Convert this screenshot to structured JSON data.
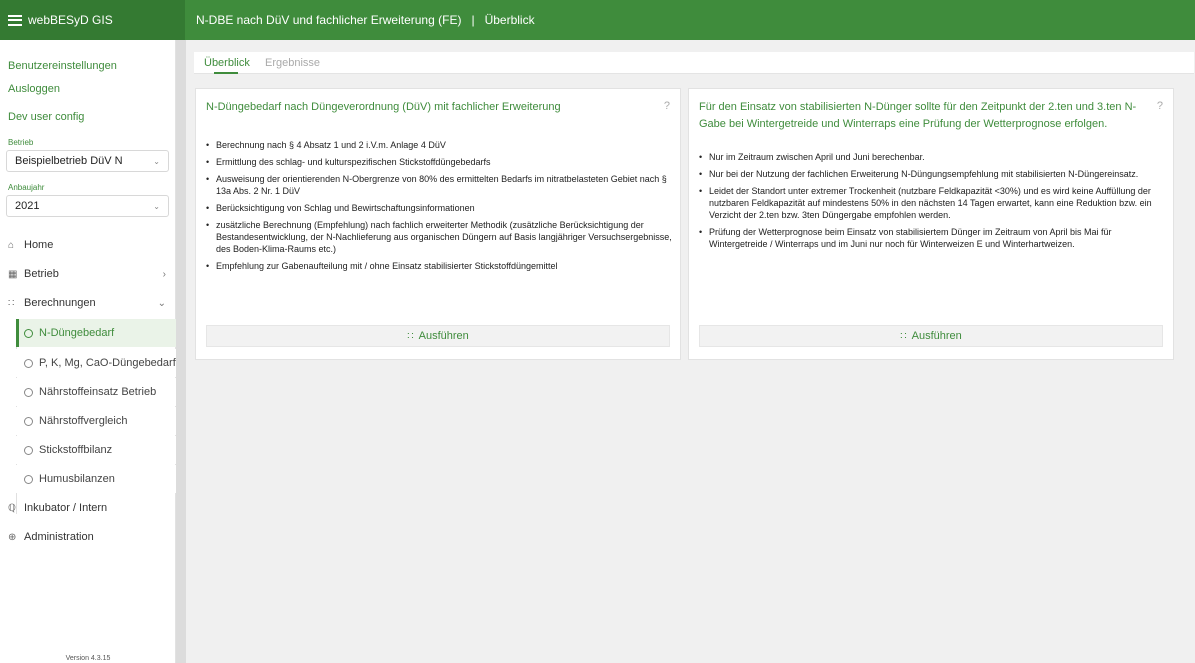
{
  "app": {
    "brand": "webBESyD GIS",
    "title": "N-DBE nach DüV und fachlicher Erweiterung (FE)   |   Überblick"
  },
  "sidebar": {
    "links": [
      "Benutzereinstellungen",
      "Ausloggen",
      "Dev user config"
    ],
    "betrieb_label": "Betrieb",
    "betrieb_value": "Beispielbetrieb DüV N",
    "anbaujahr_label": "Anbaujahr",
    "anbaujahr_value": "2021",
    "nav": {
      "home": "Home",
      "betrieb": "Betrieb",
      "berechnungen": "Berechnungen",
      "inkubator": "Inkubator / Intern",
      "administration": "Administration"
    },
    "sub_items": [
      "N-Düngebedarf",
      "P, K, Mg, CaO-Düngebedarf",
      "Nährstoffeinsatz Betrieb",
      "Nährstoffvergleich",
      "Stickstoffbilanz",
      "Humusbilanzen"
    ],
    "version": "Version 4.3.15"
  },
  "tabs": [
    "Überblick",
    "Ergebnisse"
  ],
  "cards": [
    {
      "title": "N-Düngebedarf nach Düngeverordnung (DüV) mit fachlicher Erweiterung",
      "help": "?",
      "bullets": [
        "Berechnung nach § 4 Absatz 1 und 2 i.V.m. Anlage 4 DüV",
        "Ermittlung des schlag- und kulturspezifischen Stickstoffdüngebedarfs",
        "Ausweisung der orientierenden N-Obergrenze von 80% des ermittelten Bedarfs im nitratbelasteten Gebiet nach § 13a Abs. 2 Nr. 1 DüV",
        "Berücksichtigung von Schlag und Bewirtschaftungsinformationen",
        "zusätzliche Berechnung (Empfehlung) nach fachlich erweiterter Methodik (zusätzliche Berücksichtigung der Bestandesentwicklung, der N-Nachlieferung aus organischen Düngern auf Basis langjähriger Versuchsergebnisse, des Boden-Klima-Raums etc.)",
        "Empfehlung zur Gabenaufteilung mit / ohne Einsatz stabilisierter Stickstoffdüngemittel"
      ],
      "button": "Ausführen"
    },
    {
      "title": "Für den Einsatz von stabilisierten N-Dünger sollte für den Zeitpunkt der 2.ten und 3.ten N-Gabe bei Wintergetreide und Winterraps eine Prüfung der Wetterprognose erfolgen.",
      "help": "?",
      "bullets": [
        "Nur im Zeitraum zwischen April und Juni berechenbar.",
        "Nur bei der Nutzung der fachlichen Erweiterung N-Düngungsempfehlung mit stabilisierten N-Düngereinsatz.",
        "Leidet der Standort unter extremer Trockenheit (nutzbare Feldkapazität <30%) und es wird keine Auffüllung der nutzbaren Feldkapazität auf mindestens 50% in den nächsten 14 Tagen erwartet, kann eine Reduktion bzw. ein Verzicht der 2.ten bzw. 3ten Düngergabe empfohlen werden.",
        "Prüfung der Wetterprognose beim Einsatz von stabilisiertem Dünger im Zeitraum von April bis Mai für Wintergetreide / Winterraps und im Juni nur noch für Winterweizen E und Winterhartweizen."
      ],
      "button": "Ausführen"
    }
  ]
}
